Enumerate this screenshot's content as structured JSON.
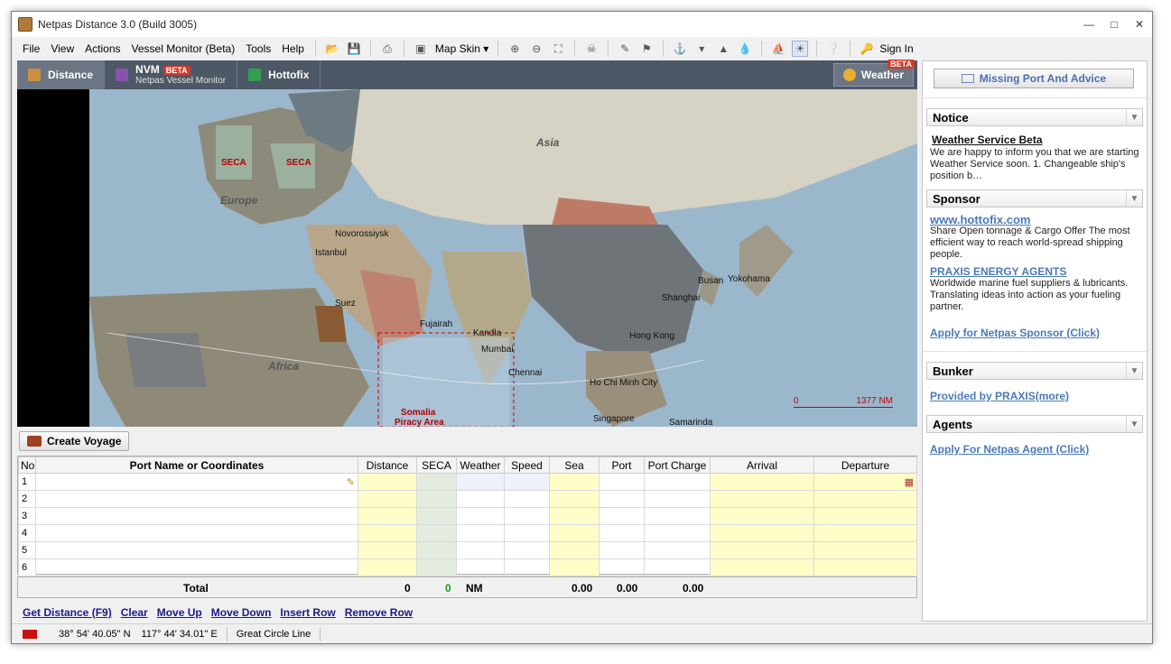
{
  "window": {
    "title": "Netpas Distance 3.0 (Build 3005)"
  },
  "menu": {
    "file": "File",
    "view": "View",
    "actions": "Actions",
    "vessel_monitor": "Vessel Monitor (Beta)",
    "tools": "Tools",
    "help": "Help",
    "map_skin": "Map Skin",
    "sign_in": "Sign In"
  },
  "tabs": {
    "distance": "Distance",
    "nvm": "NVM",
    "nvm_sub": "Netpas Vessel Monitor",
    "beta": "BETA",
    "hottofix": "Hottofix",
    "weather": "Weather"
  },
  "map": {
    "labels": {
      "asia": "Asia",
      "europe": "Europe",
      "africa": "Africa",
      "seca1": "SECA",
      "seca2": "SECA",
      "novorossiysk": "Novorossiysk",
      "istanbul": "Istanbul",
      "suez": "Suez",
      "fujairah": "Fujairah",
      "kandla": "Kandla",
      "mumbai": "Mumbai",
      "chennai": "Chennai",
      "busan": "Busan",
      "yokohama": "Yokohama",
      "shanghai": "Shanghai",
      "hongkong": "Hong Kong",
      "hochiminh": "Ho Chi Minh City",
      "singapore": "Singapore",
      "samarinda": "Samarinda",
      "somalia": "Somalia",
      "piracy": "Piracy Area"
    },
    "scale": {
      "start": "0",
      "end": "1377 NM"
    }
  },
  "voyage": {
    "create_label": "Create Voyage"
  },
  "grid": {
    "headers": [
      "No",
      "Port Name or Coordinates",
      "Distance",
      "SECA",
      "Weather",
      "Speed",
      "Sea",
      "Port",
      "Port Charge",
      "Arrival",
      "Departure"
    ],
    "rows": [
      "1",
      "2",
      "3",
      "4",
      "5",
      "6"
    ]
  },
  "totals": {
    "label": "Total",
    "distance": "0",
    "seca": "0",
    "unit": "NM",
    "sea": "0.00",
    "port": "0.00",
    "port_charge": "0.00"
  },
  "actions": {
    "get_distance": "Get Distance (F9)",
    "clear": "Clear",
    "move_up": "Move Up",
    "move_down": "Move Down",
    "insert_row": "Insert Row",
    "remove_row": "Remove Row"
  },
  "status": {
    "lat": "38° 54' 40.05\" N",
    "lon": "117° 44' 34.01\" E",
    "route": "Great Circle Line"
  },
  "sidebar": {
    "missing_port": "Missing Port And Advice",
    "notice": {
      "title": "Notice",
      "headline": "Weather Service Beta",
      "body": "We are happy to inform you that we are starting Weather Service soon. 1. Changeable ship's position b…"
    },
    "sponsor": {
      "title": "Sponsor",
      "link1": "www.hottofix.com",
      "text1": "Share Open tonnage & Cargo Offer The most efficient way to reach world-spread shipping people.",
      "link2": "PRAXIS ENERGY AGENTS",
      "text2": "Worldwide marine fuel suppliers & lubricants. Translating ideas into action as your fueling partner.",
      "apply": "Apply for Netpas Sponsor (Click)"
    },
    "bunker": {
      "title": "Bunker",
      "link": "Provided by PRAXIS(more)"
    },
    "agents": {
      "title": "Agents",
      "link": "Apply For Netpas Agent (Click)"
    }
  }
}
